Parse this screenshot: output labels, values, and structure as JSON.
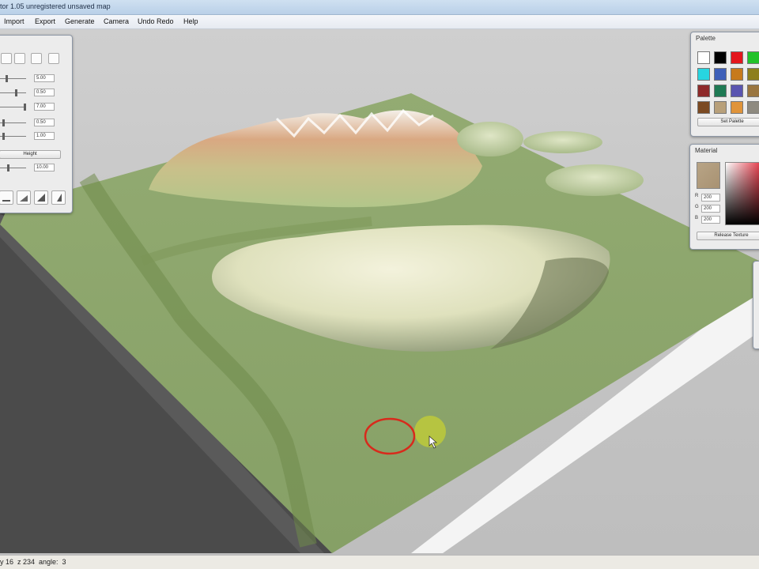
{
  "window": {
    "title": "tor 1.05 unregistered  unsaved map"
  },
  "menu": [
    "Import",
    "Export",
    "Generate",
    "Camera",
    "Undo Redo",
    "Help"
  ],
  "tool_panel": {
    "slider_values": [
      "5.00",
      "0.50",
      "7.00",
      "0.50",
      "1.00"
    ],
    "height_button": "Height",
    "extra_value": "10.00",
    "bottom_buttons": [
      "flatten-tool-icon",
      "smooth-tool-icon",
      "raise-tool-icon",
      "lower-tool-icon"
    ]
  },
  "palette": {
    "title": "Palette",
    "swatches": [
      "#ffffff",
      "#000000",
      "#e3161d",
      "#22c22a",
      "#27d5e0",
      "#3e5fb8",
      "#c77a1c",
      "#8d7f1c",
      "#8e2a2a",
      "#1f7a54",
      "#5a55b0",
      "#9a7640",
      "#7b4a22",
      "#b8a07a",
      "#e0943a",
      "#8e8a80"
    ],
    "set_button": "Set Palette"
  },
  "material": {
    "title": "Material",
    "r_label": "R",
    "g_label": "G",
    "b_label": "B",
    "r": "200",
    "g": "200",
    "b": "200",
    "release_button": "Release Texture"
  },
  "status": {
    "text": "y 16  z 234  angle:  3"
  },
  "colors": {
    "grass": "#8fa66e",
    "brush_ring": "#d82a1c",
    "brush_marker": "#c4cf34"
  }
}
